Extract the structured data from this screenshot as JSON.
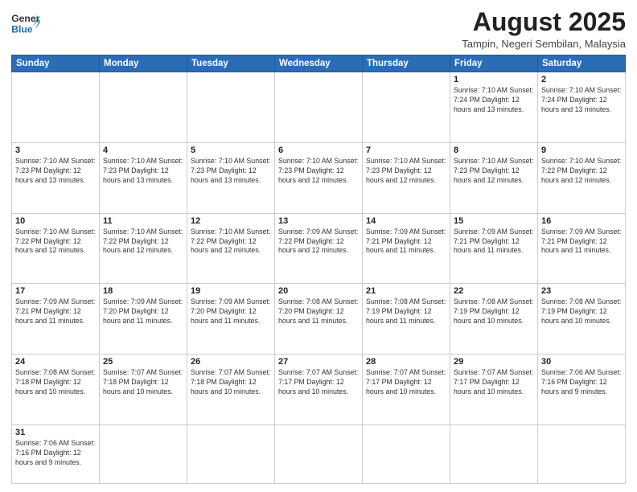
{
  "header": {
    "logo_general": "General",
    "logo_blue": "Blue",
    "title": "August 2025",
    "subtitle": "Tampin, Negeri Sembilan, Malaysia"
  },
  "weekdays": [
    "Sunday",
    "Monday",
    "Tuesday",
    "Wednesday",
    "Thursday",
    "Friday",
    "Saturday"
  ],
  "weeks": [
    [
      {
        "day": "",
        "info": ""
      },
      {
        "day": "",
        "info": ""
      },
      {
        "day": "",
        "info": ""
      },
      {
        "day": "",
        "info": ""
      },
      {
        "day": "",
        "info": ""
      },
      {
        "day": "1",
        "info": "Sunrise: 7:10 AM\nSunset: 7:24 PM\nDaylight: 12 hours\nand 13 minutes."
      },
      {
        "day": "2",
        "info": "Sunrise: 7:10 AM\nSunset: 7:24 PM\nDaylight: 12 hours\nand 13 minutes."
      }
    ],
    [
      {
        "day": "3",
        "info": "Sunrise: 7:10 AM\nSunset: 7:23 PM\nDaylight: 12 hours\nand 13 minutes."
      },
      {
        "day": "4",
        "info": "Sunrise: 7:10 AM\nSunset: 7:23 PM\nDaylight: 12 hours\nand 13 minutes."
      },
      {
        "day": "5",
        "info": "Sunrise: 7:10 AM\nSunset: 7:23 PM\nDaylight: 12 hours\nand 13 minutes."
      },
      {
        "day": "6",
        "info": "Sunrise: 7:10 AM\nSunset: 7:23 PM\nDaylight: 12 hours\nand 12 minutes."
      },
      {
        "day": "7",
        "info": "Sunrise: 7:10 AM\nSunset: 7:23 PM\nDaylight: 12 hours\nand 12 minutes."
      },
      {
        "day": "8",
        "info": "Sunrise: 7:10 AM\nSunset: 7:23 PM\nDaylight: 12 hours\nand 12 minutes."
      },
      {
        "day": "9",
        "info": "Sunrise: 7:10 AM\nSunset: 7:22 PM\nDaylight: 12 hours\nand 12 minutes."
      }
    ],
    [
      {
        "day": "10",
        "info": "Sunrise: 7:10 AM\nSunset: 7:22 PM\nDaylight: 12 hours\nand 12 minutes."
      },
      {
        "day": "11",
        "info": "Sunrise: 7:10 AM\nSunset: 7:22 PM\nDaylight: 12 hours\nand 12 minutes."
      },
      {
        "day": "12",
        "info": "Sunrise: 7:10 AM\nSunset: 7:22 PM\nDaylight: 12 hours\nand 12 minutes."
      },
      {
        "day": "13",
        "info": "Sunrise: 7:09 AM\nSunset: 7:22 PM\nDaylight: 12 hours\nand 12 minutes."
      },
      {
        "day": "14",
        "info": "Sunrise: 7:09 AM\nSunset: 7:21 PM\nDaylight: 12 hours\nand 11 minutes."
      },
      {
        "day": "15",
        "info": "Sunrise: 7:09 AM\nSunset: 7:21 PM\nDaylight: 12 hours\nand 11 minutes."
      },
      {
        "day": "16",
        "info": "Sunrise: 7:09 AM\nSunset: 7:21 PM\nDaylight: 12 hours\nand 11 minutes."
      }
    ],
    [
      {
        "day": "17",
        "info": "Sunrise: 7:09 AM\nSunset: 7:21 PM\nDaylight: 12 hours\nand 11 minutes."
      },
      {
        "day": "18",
        "info": "Sunrise: 7:09 AM\nSunset: 7:20 PM\nDaylight: 12 hours\nand 11 minutes."
      },
      {
        "day": "19",
        "info": "Sunrise: 7:09 AM\nSunset: 7:20 PM\nDaylight: 12 hours\nand 11 minutes."
      },
      {
        "day": "20",
        "info": "Sunrise: 7:08 AM\nSunset: 7:20 PM\nDaylight: 12 hours\nand 11 minutes."
      },
      {
        "day": "21",
        "info": "Sunrise: 7:08 AM\nSunset: 7:19 PM\nDaylight: 12 hours\nand 11 minutes."
      },
      {
        "day": "22",
        "info": "Sunrise: 7:08 AM\nSunset: 7:19 PM\nDaylight: 12 hours\nand 10 minutes."
      },
      {
        "day": "23",
        "info": "Sunrise: 7:08 AM\nSunset: 7:19 PM\nDaylight: 12 hours\nand 10 minutes."
      }
    ],
    [
      {
        "day": "24",
        "info": "Sunrise: 7:08 AM\nSunset: 7:18 PM\nDaylight: 12 hours\nand 10 minutes."
      },
      {
        "day": "25",
        "info": "Sunrise: 7:07 AM\nSunset: 7:18 PM\nDaylight: 12 hours\nand 10 minutes."
      },
      {
        "day": "26",
        "info": "Sunrise: 7:07 AM\nSunset: 7:18 PM\nDaylight: 12 hours\nand 10 minutes."
      },
      {
        "day": "27",
        "info": "Sunrise: 7:07 AM\nSunset: 7:17 PM\nDaylight: 12 hours\nand 10 minutes."
      },
      {
        "day": "28",
        "info": "Sunrise: 7:07 AM\nSunset: 7:17 PM\nDaylight: 12 hours\nand 10 minutes."
      },
      {
        "day": "29",
        "info": "Sunrise: 7:07 AM\nSunset: 7:17 PM\nDaylight: 12 hours\nand 10 minutes."
      },
      {
        "day": "30",
        "info": "Sunrise: 7:06 AM\nSunset: 7:16 PM\nDaylight: 12 hours\nand 9 minutes."
      }
    ],
    [
      {
        "day": "31",
        "info": "Sunrise: 7:06 AM\nSunset: 7:16 PM\nDaylight: 12 hours\nand 9 minutes."
      },
      {
        "day": "",
        "info": ""
      },
      {
        "day": "",
        "info": ""
      },
      {
        "day": "",
        "info": ""
      },
      {
        "day": "",
        "info": ""
      },
      {
        "day": "",
        "info": ""
      },
      {
        "day": "",
        "info": ""
      }
    ]
  ]
}
